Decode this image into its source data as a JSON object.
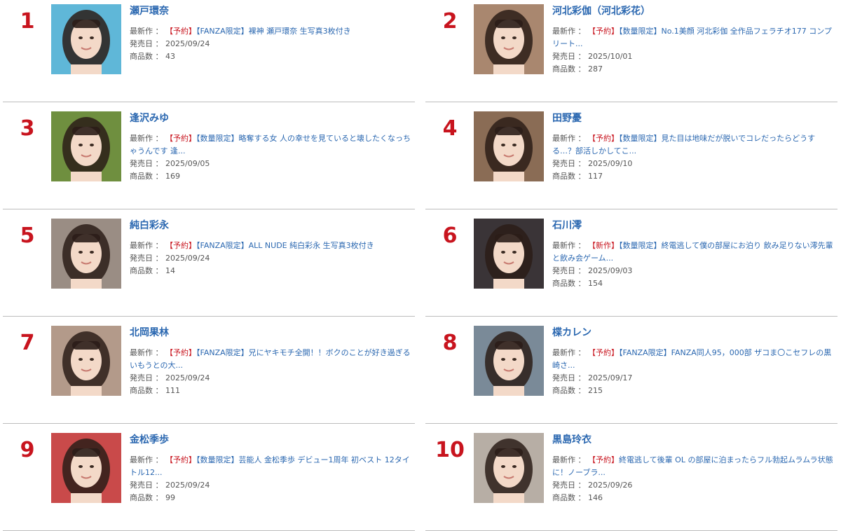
{
  "labels": {
    "latest": "最新作",
    "release": "発売日",
    "count": "商品数",
    "sep": "："
  },
  "colors": {
    "rank": "#c8141e",
    "link": "#2a67b0",
    "divider": "#bdbdbd"
  },
  "actresses": [
    {
      "rank": "1",
      "name": "瀬戸環奈",
      "tag1": "【予約】",
      "tag2": "【FANZA限定】",
      "title": "裸神 瀬戸環奈 生写真3枚付き",
      "release": "2025/09/24",
      "count": "43",
      "bg": "#5fb7d8"
    },
    {
      "rank": "2",
      "name": "河北彩伽（河北彩花）",
      "tag1": "【予約】",
      "tag2": "【数量限定】",
      "title": "No.1美顔 河北彩伽 全作品フェラチオ177 コンプリート...",
      "release": "2025/10/01",
      "count": "287",
      "bg": "#a9876f"
    },
    {
      "rank": "3",
      "name": "逢沢みゆ",
      "tag1": "【予約】",
      "tag2": "【数量限定】",
      "title": "略奪する女 人の幸せを見ていると壊したくなっちゃうんです 逢...",
      "release": "2025/09/05",
      "count": "169",
      "bg": "#6f8f3f"
    },
    {
      "rank": "4",
      "name": "田野憂",
      "tag1": "【予約】",
      "tag2": "【数量限定】",
      "title": "見た目は地味だが脱いでコレだったらどうする…？部活しかしてこ...",
      "release": "2025/09/10",
      "count": "117",
      "bg": "#8a6c55"
    },
    {
      "rank": "5",
      "name": "純白彩永",
      "tag1": "【予約】",
      "tag2": "【FANZA限定】",
      "title": "ALL NUDE 純白彩永 生写真3枚付き",
      "release": "2025/09/24",
      "count": "14",
      "bg": "#9a8d84"
    },
    {
      "rank": "6",
      "name": "石川澪",
      "tag1": "【新作】",
      "tag2": "【数量限定】",
      "title": "終電逃して僕の部屋にお泊り 飲み足りない澪先輩と飲み会ゲーム...",
      "release": "2025/09/03",
      "count": "154",
      "bg": "#3a3437"
    },
    {
      "rank": "7",
      "name": "北岡果林",
      "tag1": "【予約】",
      "tag2": "【FANZA限定】",
      "title": "兄にヤキモチ全開！！ボクのことが好き過ぎるいもうとの大...",
      "release": "2025/09/24",
      "count": "111",
      "bg": "#b39a8a"
    },
    {
      "rank": "8",
      "name": "楪カレン",
      "tag1": "【予約】",
      "tag2": "【FANZA限定】",
      "title": "FANZA同人95，000部 ザコま〇こセフレの黒崎さ...",
      "release": "2025/09/17",
      "count": "215",
      "bg": "#7a8a98"
    },
    {
      "rank": "9",
      "name": "金松季歩",
      "tag1": "【予約】",
      "tag2": "【数量限定】",
      "title": "芸能人 金松季歩 デビュー1周年 初ベスト 12タイトル12...",
      "release": "2025/09/24",
      "count": "99",
      "bg": "#c94a4a"
    },
    {
      "rank": "10",
      "name": "黒島玲衣",
      "tag1": "【予約】",
      "tag2": "",
      "title": "終電逃して後輩 OL の部屋に泊まったらフル勃起ムラムラ状態に！ノーブラ...",
      "release": "2025/09/26",
      "count": "146",
      "bg": "#b7aea5"
    }
  ]
}
